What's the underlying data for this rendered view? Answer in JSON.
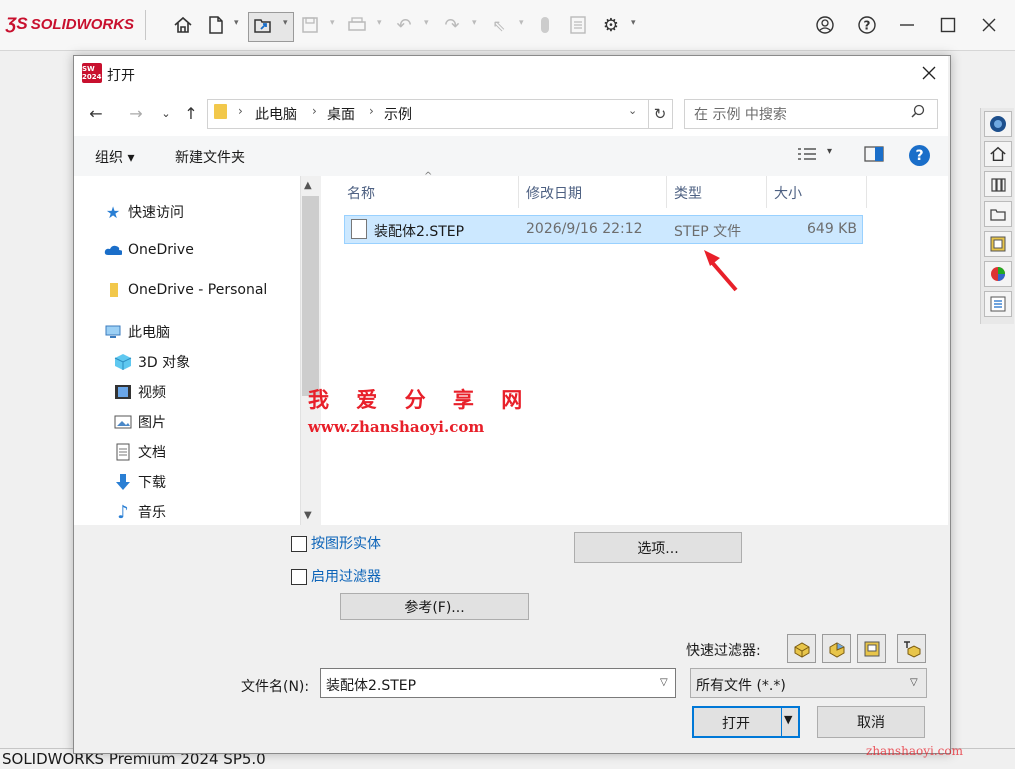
{
  "app": {
    "logo": "SOLIDWORKS",
    "status_text": "SOLIDWORKS Premium 2024 SP5.0",
    "toolbar_icons": [
      "home-icon",
      "new-document-icon",
      "open-document-icon",
      "save-icon",
      "print-icon",
      "undo-icon",
      "redo-icon",
      "select-icon",
      "rebuild-icon",
      "file-properties-icon",
      "options-icon"
    ],
    "window_icons": [
      "user-icon",
      "help-icon",
      "minimize-icon",
      "maximize-icon",
      "close-icon"
    ],
    "task_pane_icons": [
      "solidworks-resources-icon",
      "home-icon",
      "design-library-icon",
      "file-explorer-icon",
      "view-palette-icon",
      "appearances-icon",
      "custom-properties-icon"
    ]
  },
  "dialog": {
    "title": "打开",
    "icon_text": "SW 2024",
    "breadcrumb": [
      "此电脑",
      "桌面",
      "示例"
    ],
    "search_placeholder": "在 示例 中搜索",
    "commands": {
      "organize": "组织 ▾",
      "new_folder": "新建文件夹"
    },
    "nav_pane": {
      "quick_access": "快速访问",
      "onedrive": "OneDrive",
      "onedrive_personal": "OneDrive - Personal",
      "this_pc": "此电脑",
      "children": [
        "3D 对象",
        "视频",
        "图片",
        "文档",
        "下载",
        "音乐"
      ]
    },
    "columns": {
      "name": "名称",
      "date": "修改日期",
      "type": "类型",
      "size": "大小"
    },
    "files": [
      {
        "name": "装配体2.STEP",
        "date": "2026/9/16 22:12",
        "type": "STEP 文件",
        "size": "649 KB",
        "selected": true
      }
    ],
    "options": {
      "map_bodies": "按图形实体",
      "enable_filter": "启用过滤器",
      "options_button": "选项...",
      "reference_button": "参考(F)..."
    },
    "quick_filter_label": "快速过滤器:",
    "filename_label": "文件名(N):",
    "filename_value": "装配体2.STEP",
    "filetype_value": "所有文件 (*.*)",
    "open_button": "打开",
    "cancel_button": "取消"
  },
  "watermark": {
    "title": "我 爱 分 享 网",
    "url": "www.zhanshaoyi.com",
    "corner": "zhanshaoyi.com"
  },
  "colors": {
    "brand_red": "#c8102e",
    "selection": "#cce8ff",
    "link_blue": "#0b63b8",
    "watermark": "#e8202a"
  }
}
